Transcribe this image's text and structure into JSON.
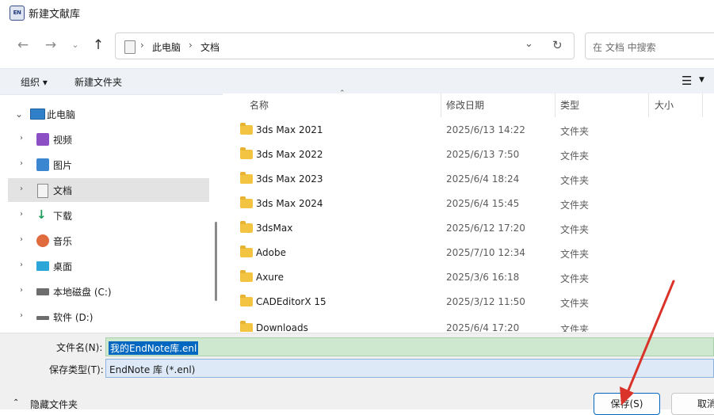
{
  "window": {
    "app_icon_text": "EN",
    "title": "新建文献库"
  },
  "nav": {
    "breadcrumb": [
      "此电脑",
      "文档"
    ],
    "search_placeholder": "在 文档 中搜索"
  },
  "toolbar": {
    "organize_label": "组织 ▾",
    "new_folder_label": "新建文件夹"
  },
  "sidebar": {
    "items": [
      {
        "label": "此电脑",
        "icon": "computer-icon",
        "expanded": true
      },
      {
        "label": "视频",
        "icon": "video-icon"
      },
      {
        "label": "图片",
        "icon": "picture-icon"
      },
      {
        "label": "文档",
        "icon": "document-icon",
        "selected": true
      },
      {
        "label": "下载",
        "icon": "download-icon"
      },
      {
        "label": "音乐",
        "icon": "music-icon"
      },
      {
        "label": "桌面",
        "icon": "desktop-icon"
      },
      {
        "label": "本地磁盘 (C:)",
        "icon": "drive-icon"
      },
      {
        "label": "软件 (D:)",
        "icon": "drive-icon"
      }
    ]
  },
  "file_list": {
    "columns": [
      "名称",
      "修改日期",
      "类型",
      "大小"
    ],
    "rows": [
      {
        "name": "3ds Max 2021",
        "date": "2025/6/13 14:22",
        "type": "文件夹"
      },
      {
        "name": "3ds Max 2022",
        "date": "2025/6/13 7:50",
        "type": "文件夹"
      },
      {
        "name": "3ds Max 2023",
        "date": "2025/6/4 18:24",
        "type": "文件夹"
      },
      {
        "name": "3ds Max 2024",
        "date": "2025/6/4 15:45",
        "type": "文件夹"
      },
      {
        "name": "3dsMax",
        "date": "2025/6/12 17:20",
        "type": "文件夹"
      },
      {
        "name": "Adobe",
        "date": "2025/7/10 12:34",
        "type": "文件夹"
      },
      {
        "name": "Axure",
        "date": "2025/3/6 16:18",
        "type": "文件夹"
      },
      {
        "name": "CADEditorX 15",
        "date": "2025/3/12 11:50",
        "type": "文件夹"
      },
      {
        "name": "Downloads",
        "date": "2025/6/4 17:20",
        "type": "文件夹"
      }
    ]
  },
  "save_panel": {
    "filename_label": "文件名(N):",
    "filename_value": "我的EndNote库.enl",
    "filetype_label": "保存类型(T):",
    "filetype_value": "EndNote 库 (*.enl)",
    "hide_folders_label": "隐藏文件夹",
    "save_button": "保存(S)",
    "cancel_button": "取消"
  },
  "colors": {
    "accent": "#0067c0",
    "filename_highlight": "#cde8cf",
    "filetype_bg": "#dde9f7",
    "annotation_arrow": "#d9332a"
  }
}
